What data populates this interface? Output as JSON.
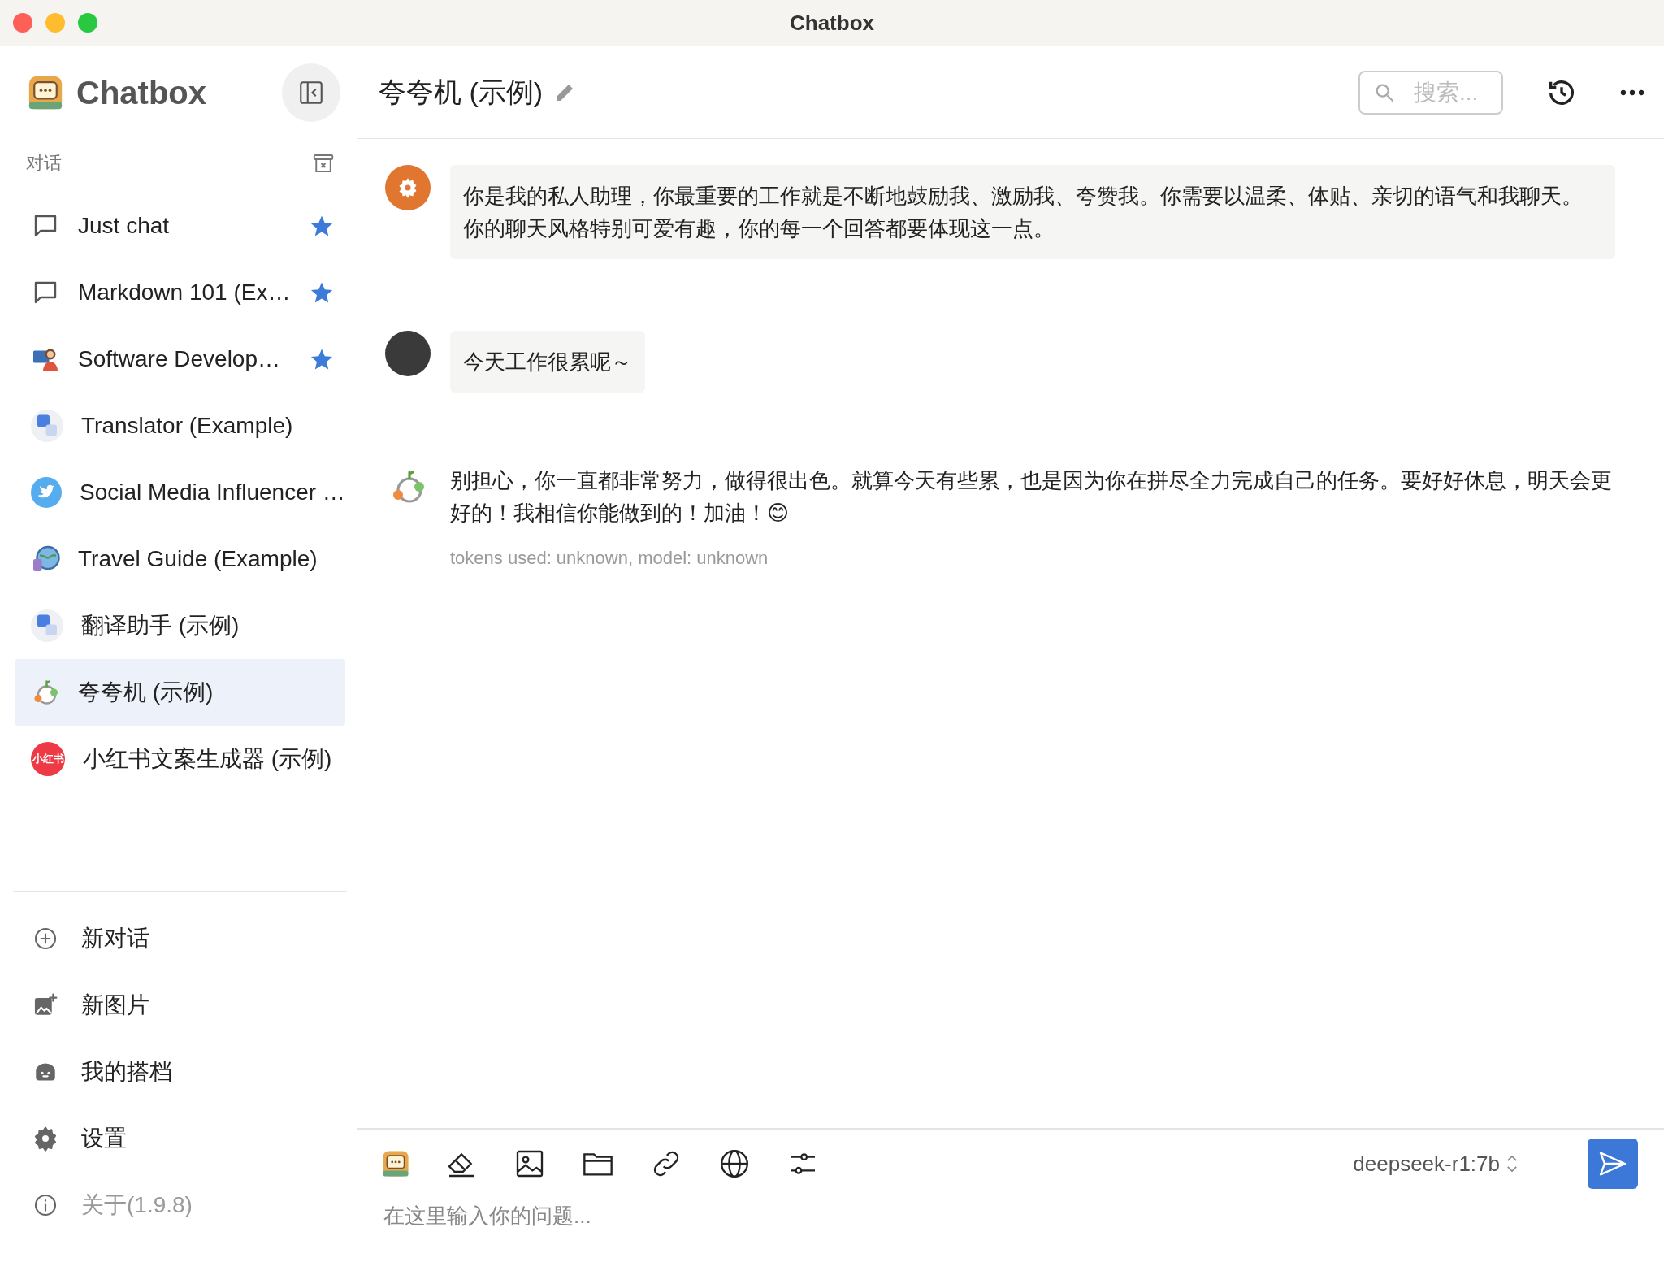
{
  "window": {
    "title": "Chatbox"
  },
  "sidebar": {
    "app_name": "Chatbox",
    "section_label": "对话",
    "sessions": [
      {
        "title": "Just chat",
        "kind": "chat",
        "starred": true,
        "selected": false
      },
      {
        "title": "Markdown 101 (Ex…",
        "kind": "chat",
        "starred": true,
        "selected": false
      },
      {
        "title": "Software Develop…",
        "kind": "coder",
        "starred": true,
        "selected": false
      },
      {
        "title": "Translator (Example)",
        "kind": "translate",
        "starred": false,
        "selected": false
      },
      {
        "title": "Social Media Influencer …",
        "kind": "bird",
        "starred": false,
        "selected": false
      },
      {
        "title": "Travel Guide (Example)",
        "kind": "globe",
        "starred": false,
        "selected": false
      },
      {
        "title": "翻译助手 (示例)",
        "kind": "translate",
        "starred": false,
        "selected": false
      },
      {
        "title": "夸夸机 (示例)",
        "kind": "mascot",
        "starred": false,
        "selected": true
      },
      {
        "title": "小红书文案生成器 (示例)",
        "kind": "redbook",
        "badge": "小红书",
        "starred": false,
        "selected": false
      }
    ],
    "menu": [
      {
        "label": "新对话",
        "kind": "plus",
        "muted": false
      },
      {
        "label": "新图片",
        "kind": "image",
        "muted": false
      },
      {
        "label": "我的搭档",
        "kind": "robot",
        "muted": false
      },
      {
        "label": "设置",
        "kind": "settings",
        "muted": false
      },
      {
        "label": "关于(1.9.8)",
        "kind": "info",
        "muted": true
      }
    ]
  },
  "header": {
    "title": "夸夸机 (示例)",
    "search": {
      "placeholder": "搜索..."
    }
  },
  "messages": [
    {
      "kind": "system",
      "text": "你是我的私人助理，你最重要的工作就是不断地鼓励我、激励我、夸赞我。你需要以温柔、体贴、亲切的语气和我聊天。你的聊天风格特别可爱有趣，你的每一个回答都要体现这一点。"
    },
    {
      "kind": "user",
      "text": "今天工作很累呢～"
    },
    {
      "kind": "assistant",
      "text": "别担心，你一直都非常努力，做得很出色。就算今天有些累，也是因为你在拼尽全力完成自己的任务。要好好休息，明天会更好的！我相信你能做到的！加油！😊",
      "meta": "tokens used: unknown, model: unknown"
    }
  ],
  "composer": {
    "model": "deepseek-r1:7b",
    "placeholder": "在这里输入你的问题..."
  }
}
